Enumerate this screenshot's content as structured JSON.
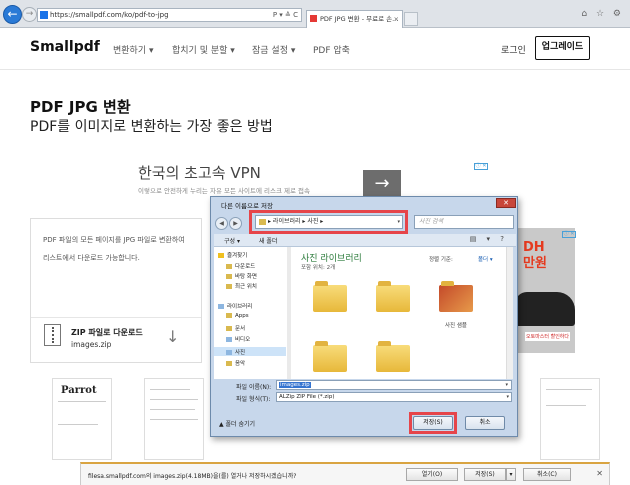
{
  "browser": {
    "url": "https://smallpdf.com/ko/pdf-to-jpg",
    "tab_title": "PDF JPG 변환 - 무료로 손...",
    "tab_close": "×",
    "address_controls": "P ▾ ≙ C",
    "back": "←",
    "forward": "→",
    "right_icons": "⌂ ☆ ⚙"
  },
  "header": {
    "logo": "Smallpdf",
    "nav": [
      "변환하기 ▾",
      "합치기 및 분할 ▾",
      "잠금 설정 ▾",
      "PDF 압축"
    ],
    "login": "로그인",
    "upgrade": "업그레이드"
  },
  "page": {
    "title": "PDF JPG 변환",
    "subtitle": "PDF를 이미지로 변환하는 가장 좋은 방법"
  },
  "ad1": {
    "title": "한국의 초고속 VPN",
    "subtitle": "이렇으로 안전하게 누리는 자유 모든 사이트에 리스크 제로 접속",
    "arrow": "→",
    "badge": "ⓘ ✕"
  },
  "info": {
    "line1": "PDF 파일의 모든 페이지를 JPG 파일로 변환하여",
    "line2": "리스트에서 다운로드 가능합니다.",
    "zip_label": "ZIP 파일로 다운로드",
    "zip_file": "images.zip",
    "download_arrow": "↓"
  },
  "ad2": {
    "text1": "DH",
    "text2": "만원",
    "label": "오토마스터 할인하다",
    "badge": "ⓘ ✕"
  },
  "thumbnail": {
    "parrot": "Parrot"
  },
  "dialog": {
    "title": "다른 이름으로 저장",
    "close": "✕",
    "nav_back": "◀",
    "nav_forward": "▶",
    "path": "▸ 라이브러리 ▸ 사진 ▸",
    "path_dropdown": "▾",
    "search_placeholder": "사진 검색",
    "organize": "구성 ▾",
    "new_folder": "새 폴더",
    "view_icons": "▤ ▾ ?",
    "nav_items": [
      "즐겨찾기",
      "다운로드",
      "바탕 화면",
      "최근 위치",
      "라이브러리",
      "Apps",
      "문서",
      "비디오",
      "사진",
      "음악"
    ],
    "library_title": "사진 라이브러리",
    "library_sub": "포함 위치: 2개",
    "arrange_label": "정렬 기준:",
    "arrange_value": "폴더 ▾",
    "folder_name": "사진 샘플",
    "file_name_label": "파일 이름(N):",
    "file_name_value": "images.zip",
    "file_type_label": "파일 형식(T):",
    "file_type_value": "ALZip ZIP File (*.zip)",
    "hide_folders": "▲ 폴더 숨기기",
    "save": "저장(S)",
    "cancel": "취소"
  },
  "download_bar": {
    "text": "filesa.smallpdf.com의 images.zip(4.18MB)을(를) 열거나 저장하시겠습니까?",
    "open": "열기(O)",
    "save": "저장(S)",
    "save_dropdown": "▾",
    "cancel": "취소(C)",
    "close": "✕"
  },
  "colors": {
    "highlight_red": "#e6454a",
    "back_button": "#2a7ad6",
    "library_green": "#2a7a3a"
  }
}
